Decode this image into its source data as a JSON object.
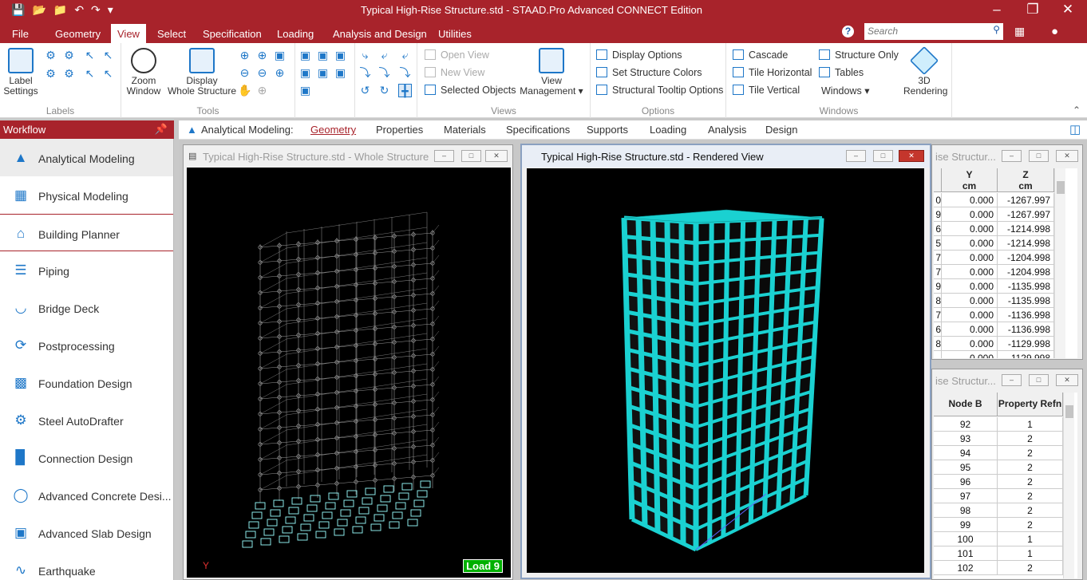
{
  "window": {
    "title": "Typical High-Rise Structure.std - STAAD.Pro Advanced CONNECT Edition"
  },
  "menu": {
    "items": [
      "File",
      "Geometry",
      "View",
      "Select",
      "Specification",
      "Loading",
      "Analysis and Design",
      "Utilities"
    ],
    "active": "View"
  },
  "search": {
    "placeholder": "Search"
  },
  "ribbon": {
    "labels_group": {
      "label_settings": "Label\nSettings",
      "name": "Labels"
    },
    "tools_group": {
      "zoom_window": "Zoom\nWindow",
      "display_whole": "Display\nWhole Structure",
      "name": "Tools"
    },
    "views_group": {
      "open_view": "Open View",
      "new_view": "New View",
      "selected_objects": "Selected Objects",
      "view_management": "View\nManagement",
      "name": "Views"
    },
    "options_group": {
      "display_options": "Display Options",
      "set_colors": "Set Structure Colors",
      "tooltip_options": "Structural Tooltip Options",
      "name": "Options"
    },
    "windows_group": {
      "cascade": "Cascade",
      "tile_horizontal": "Tile Horizontal",
      "tile_vertical": "Tile Vertical",
      "structure_only": "Structure Only",
      "tables": "Tables",
      "windows": "Windows",
      "rendering": "3D\nRendering",
      "name": "Windows"
    }
  },
  "workflow": {
    "title": "Workflow",
    "items": [
      "Analytical Modeling",
      "Physical Modeling",
      "Building Planner",
      "Piping",
      "Bridge Deck",
      "Postprocessing",
      "Foundation Design",
      "Steel AutoDrafter",
      "Connection Design",
      "Advanced Concrete Desi...",
      "Advanced Slab Design",
      "Earthquake"
    ]
  },
  "tabs": {
    "prefix": "Analytical Modeling:",
    "items": [
      "Geometry",
      "Properties",
      "Materials",
      "Specifications",
      "Supports",
      "Loading",
      "Analysis",
      "Design"
    ],
    "active": "Geometry"
  },
  "windows": {
    "whole": {
      "title": "Typical High-Rise Structure.std - Whole Structure",
      "load": "Load 9",
      "axis": "Y"
    },
    "rendered": {
      "title": "Typical High-Rise Structure.std - Rendered View"
    },
    "nodes_table": {
      "title": "ise Structur...",
      "headers": [
        [
          "Y",
          "cm"
        ],
        [
          "Z",
          "cm"
        ]
      ],
      "rows": [
        [
          "0",
          "0.000",
          "-1267.997"
        ],
        [
          "9",
          "0.000",
          "-1267.997"
        ],
        [
          "6",
          "0.000",
          "-1214.998"
        ],
        [
          "5",
          "0.000",
          "-1214.998"
        ],
        [
          "7",
          "0.000",
          "-1204.998"
        ],
        [
          "7",
          "0.000",
          "-1204.998"
        ],
        [
          "9",
          "0.000",
          "-1135.998"
        ],
        [
          "8",
          "0.000",
          "-1135.998"
        ],
        [
          "7",
          "0.000",
          "-1136.998"
        ],
        [
          "6",
          "0.000",
          "-1136.998"
        ],
        [
          "8",
          "0.000",
          "-1129.998"
        ],
        [
          "",
          "0.000",
          "-1129.998"
        ]
      ]
    },
    "beams_table": {
      "title": "ise Structur...",
      "headers": [
        "Node B",
        "Property Refn"
      ],
      "rows": [
        [
          "92",
          "1"
        ],
        [
          "93",
          "2"
        ],
        [
          "94",
          "2"
        ],
        [
          "95",
          "2"
        ],
        [
          "96",
          "2"
        ],
        [
          "97",
          "2"
        ],
        [
          "98",
          "2"
        ],
        [
          "99",
          "2"
        ],
        [
          "100",
          "1"
        ],
        [
          "101",
          "1"
        ],
        [
          "102",
          "2"
        ]
      ]
    }
  },
  "colors": {
    "brand": "#a8232b",
    "accent": "#1e77c8",
    "render": "#1ad1d1"
  }
}
